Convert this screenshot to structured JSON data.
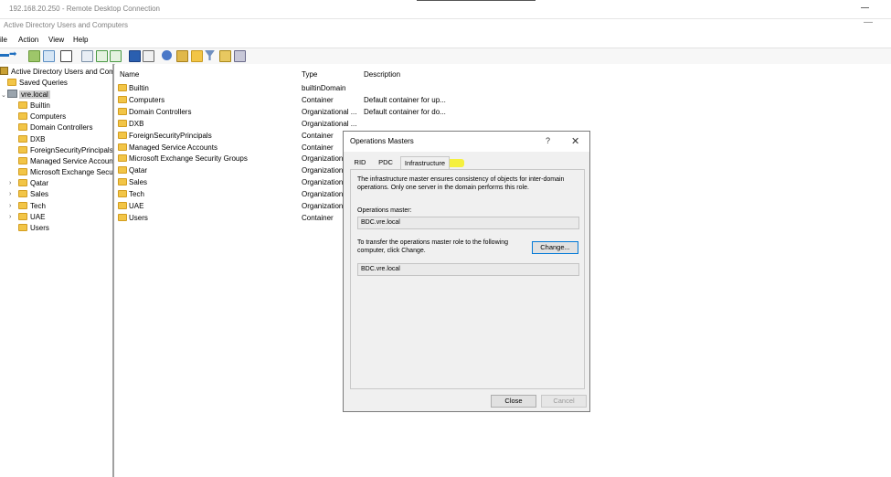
{
  "rdp": {
    "title": "192.168.20.250 - Remote Desktop Connection"
  },
  "app": {
    "title": "Active Directory Users and Computers"
  },
  "menu": [
    "ile",
    "Action",
    "View",
    "Help"
  ],
  "tree": {
    "root": "Active Directory Users and Comp",
    "saved_queries": "Saved Queries",
    "domain": "vre.local",
    "children": [
      "Builtin",
      "Computers",
      "Domain Controllers",
      "DXB",
      "ForeignSecurityPrincipals",
      "Managed Service Accoun",
      "Microsoft Exchange Secu",
      "Qatar",
      "Sales",
      "Tech",
      "UAE",
      "Users"
    ]
  },
  "list": {
    "headers": {
      "name": "Name",
      "type": "Type",
      "description": "Description"
    },
    "rows": [
      {
        "name": "Builtin",
        "type": "builtinDomain",
        "description": ""
      },
      {
        "name": "Computers",
        "type": "Container",
        "description": "Default container for up..."
      },
      {
        "name": "Domain Controllers",
        "type": "Organizational ...",
        "description": "Default container for do..."
      },
      {
        "name": "DXB",
        "type": "Organizational ...",
        "description": ""
      },
      {
        "name": "ForeignSecurityPrincipals",
        "type": "Container",
        "description": ""
      },
      {
        "name": "Managed Service Accounts",
        "type": "Container",
        "description": ""
      },
      {
        "name": "Microsoft Exchange Security Groups",
        "type": "Organization",
        "description": ""
      },
      {
        "name": "Qatar",
        "type": "Organization",
        "description": ""
      },
      {
        "name": "Sales",
        "type": "Organization",
        "description": ""
      },
      {
        "name": "Tech",
        "type": "Organization",
        "description": ""
      },
      {
        "name": "UAE",
        "type": "Organization",
        "description": ""
      },
      {
        "name": "Users",
        "type": "Container",
        "description": ""
      }
    ]
  },
  "dialog": {
    "title": "Operations Masters",
    "help": "?",
    "close": "✕",
    "tabs": [
      "RID",
      "PDC",
      "Infrastructure"
    ],
    "active_tab": "Infrastructure",
    "description": "The infrastructure master ensures consistency of objects for inter-domain operations. Only one server in the domain performs this role.",
    "ops_master_label": "Operations master:",
    "ops_master_value": "BDC.vre.local",
    "transfer_text": "To transfer the operations master role to the following computer, click Change.",
    "change_label": "Change...",
    "target_value": "BDC.vre.local",
    "close_label": "Close",
    "cancel_label": "Cancel"
  },
  "colors": {
    "folder": "#f2c547",
    "highlight": "#f5ef2a",
    "accent": "#0078d7"
  }
}
